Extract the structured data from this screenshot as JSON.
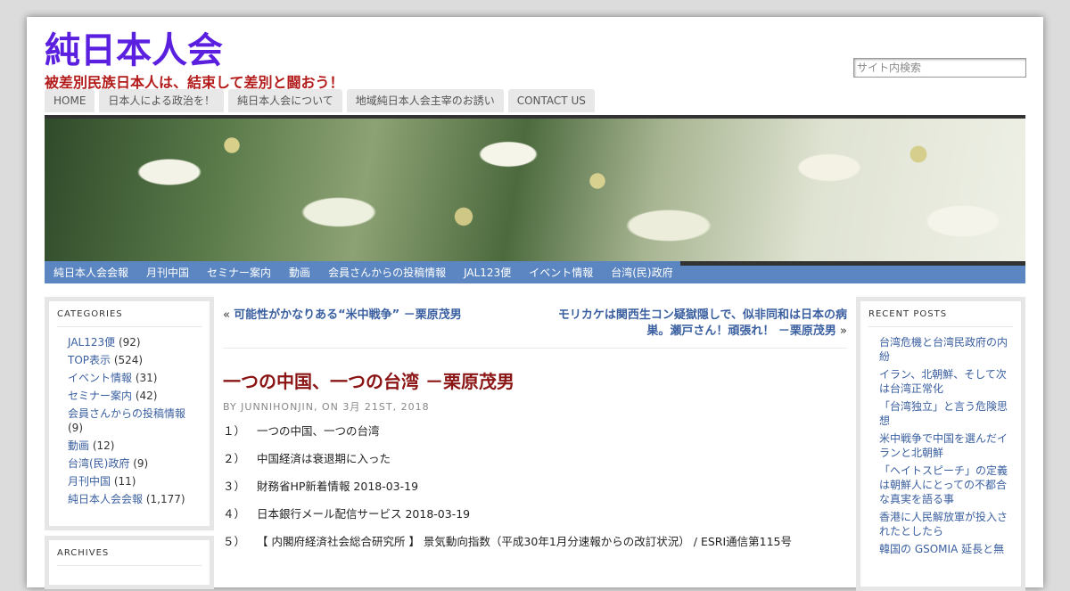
{
  "header": {
    "site_title": "純日本人会",
    "tagline": "被差別民族日本人は、結束して差別と闘おう！",
    "search_placeholder": "サイト内検索"
  },
  "top_nav": [
    "HOME",
    "日本人による政治を！",
    "純日本人会について",
    "地域純日本人会主宰のお誘い",
    "CONTACT US"
  ],
  "sub_nav": [
    "純日本人会会報",
    "月刊中国",
    "セミナー案内",
    "動画",
    "会員さんからの投稿情報",
    "JAL123便",
    "イベント情報",
    "台湾(民)政府"
  ],
  "categories": {
    "title": "CATEGORIES",
    "items": [
      {
        "label": "JAL123便",
        "count": "(92)"
      },
      {
        "label": "TOP表示",
        "count": "(524)"
      },
      {
        "label": "イベント情報",
        "count": "(31)"
      },
      {
        "label": "セミナー案内",
        "count": "(42)"
      },
      {
        "label": "会員さんからの投稿情報",
        "count": "(9)"
      },
      {
        "label": "動画",
        "count": "(12)"
      },
      {
        "label": "台湾(民)政府",
        "count": "(9)"
      },
      {
        "label": "月刊中国",
        "count": "(11)"
      },
      {
        "label": "純日本人会会報",
        "count": "(1,177)"
      }
    ]
  },
  "archives": {
    "title": "ARCHIVES"
  },
  "post_nav": {
    "prev_arrow": "«",
    "prev": "可能性がかなりある“米中戦争” －栗原茂男",
    "next_line1": "モリカケは関西生コン疑獄隠しで、似非同和は日本の病",
    "next_line2": "巣。瀬戸さん！頑張れ！ －栗原茂男",
    "next_arrow": "»"
  },
  "post": {
    "title": "一つの中国、一つの台湾 －栗原茂男",
    "meta": "BY JUNNIHONJIN, ON 3月 21ST, 2018",
    "lines": [
      {
        "num": "１）",
        "text": "一つの中国、一つの台湾"
      },
      {
        "num": "２）",
        "text": "中国経済は衰退期に入った"
      },
      {
        "num": "３）",
        "text": "財務省HP新着情報 2018-03-19"
      },
      {
        "num": "４）",
        "text": "日本銀行メール配信サービス 2018-03-19"
      },
      {
        "num": "５）",
        "text": "【 内閣府経済社会総合研究所 】 景気動向指数（平成30年1月分速報からの改訂状況） / ESRI通信第115号"
      }
    ]
  },
  "recent_posts": {
    "title": "RECENT POSTS",
    "items": [
      "台湾危機と台湾民政府の内紛",
      "イラン、北朝鮮、そして次は台湾正常化",
      "「台湾独立」と言う危険思想",
      "米中戦争で中国を選んだイランと北朝鮮",
      "「ヘイトスピーチ」の定義は朝鮮人にとっての不都合な真実を語る事",
      "香港に人民解放軍が投入されたとしたら",
      "韓国の GSOMIA 延長と無"
    ]
  }
}
